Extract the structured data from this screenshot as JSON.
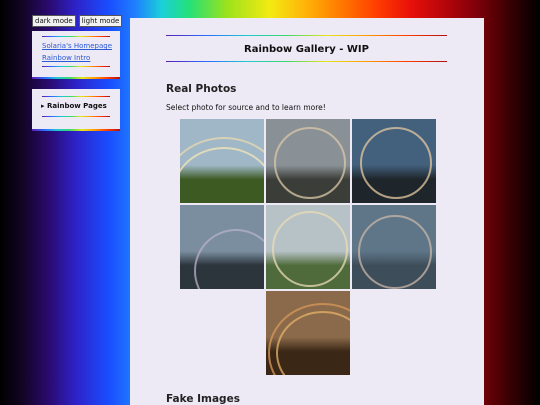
{
  "mode_buttons": {
    "dark": "dark mode",
    "light": "light mode"
  },
  "sidebar": {
    "links": [
      "Solaria's Homepage",
      "Rainbow Intro"
    ],
    "pages_toggle": "▸ Rainbow Pages"
  },
  "main": {
    "title": "Rainbow Gallery - WIP",
    "real_heading": "Real Photos",
    "intro": "Select photo for source and to learn more!",
    "fake_heading": "Fake Images"
  },
  "gallery": {
    "photos": [
      {
        "icon": "double-rainbow-over-road-photo",
        "sky": "#9fb7c6",
        "ground": "#3d5a23"
      },
      {
        "icon": "rainbow-circle-over-cliff-photo",
        "sky": "#8a9196",
        "ground": "#3b3e38"
      },
      {
        "icon": "full-circle-rainbow-at-dusk-photo",
        "sky": "#43607c",
        "ground": "#1e252b"
      },
      {
        "icon": "rainbow-seen-from-plane-wing-photo",
        "sky": "#7a8ea0",
        "ground": "#2c343c"
      },
      {
        "icon": "circular-rainbow-over-coast-photo",
        "sky": "#b7c2c6",
        "ground": "#4f6b3c"
      },
      {
        "icon": "circular-rainbow-from-aircraft-photo",
        "sky": "#5e7688",
        "ground": "#3e4d5a"
      },
      {
        "icon": "double-rainbow-sunset-field-photo",
        "sky": "#8a6a4a",
        "ground": "#3a2716"
      }
    ]
  }
}
